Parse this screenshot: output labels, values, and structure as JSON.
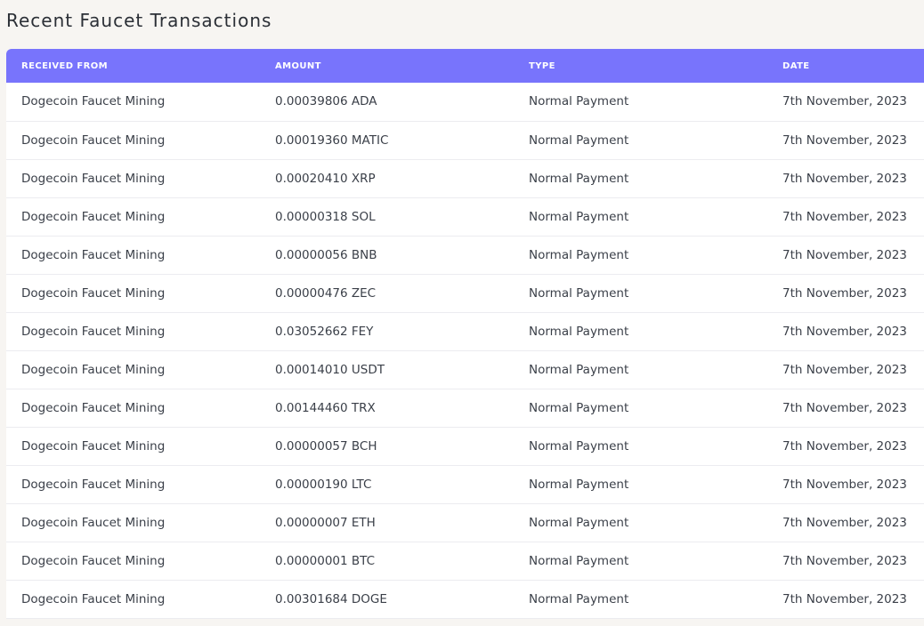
{
  "page": {
    "title": "Recent Faucet Transactions"
  },
  "table": {
    "headers": {
      "received_from": "RECEIVED FROM",
      "amount": "AMOUNT",
      "type": "TYPE",
      "date": "DATE"
    },
    "header_color": "#7874fc",
    "rows": [
      {
        "from": "Dogecoin Faucet Mining",
        "amount": "0.00039806 ADA",
        "type": "Normal Payment",
        "date": "7th November, 2023"
      },
      {
        "from": "Dogecoin Faucet Mining",
        "amount": "0.00019360 MATIC",
        "type": "Normal Payment",
        "date": "7th November, 2023"
      },
      {
        "from": "Dogecoin Faucet Mining",
        "amount": "0.00020410 XRP",
        "type": "Normal Payment",
        "date": "7th November, 2023"
      },
      {
        "from": "Dogecoin Faucet Mining",
        "amount": "0.00000318 SOL",
        "type": "Normal Payment",
        "date": "7th November, 2023"
      },
      {
        "from": "Dogecoin Faucet Mining",
        "amount": "0.00000056 BNB",
        "type": "Normal Payment",
        "date": "7th November, 2023"
      },
      {
        "from": "Dogecoin Faucet Mining",
        "amount": "0.00000476 ZEC",
        "type": "Normal Payment",
        "date": "7th November, 2023"
      },
      {
        "from": "Dogecoin Faucet Mining",
        "amount": "0.03052662 FEY",
        "type": "Normal Payment",
        "date": "7th November, 2023"
      },
      {
        "from": "Dogecoin Faucet Mining",
        "amount": "0.00014010 USDT",
        "type": "Normal Payment",
        "date": "7th November, 2023"
      },
      {
        "from": "Dogecoin Faucet Mining",
        "amount": "0.00144460 TRX",
        "type": "Normal Payment",
        "date": "7th November, 2023"
      },
      {
        "from": "Dogecoin Faucet Mining",
        "amount": "0.00000057 BCH",
        "type": "Normal Payment",
        "date": "7th November, 2023"
      },
      {
        "from": "Dogecoin Faucet Mining",
        "amount": "0.00000190 LTC",
        "type": "Normal Payment",
        "date": "7th November, 2023"
      },
      {
        "from": "Dogecoin Faucet Mining",
        "amount": "0.00000007 ETH",
        "type": "Normal Payment",
        "date": "7th November, 2023"
      },
      {
        "from": "Dogecoin Faucet Mining",
        "amount": "0.00000001 BTC",
        "type": "Normal Payment",
        "date": "7th November, 2023"
      },
      {
        "from": "Dogecoin Faucet Mining",
        "amount": "0.00301684 DOGE",
        "type": "Normal Payment",
        "date": "7th November, 2023"
      }
    ]
  }
}
